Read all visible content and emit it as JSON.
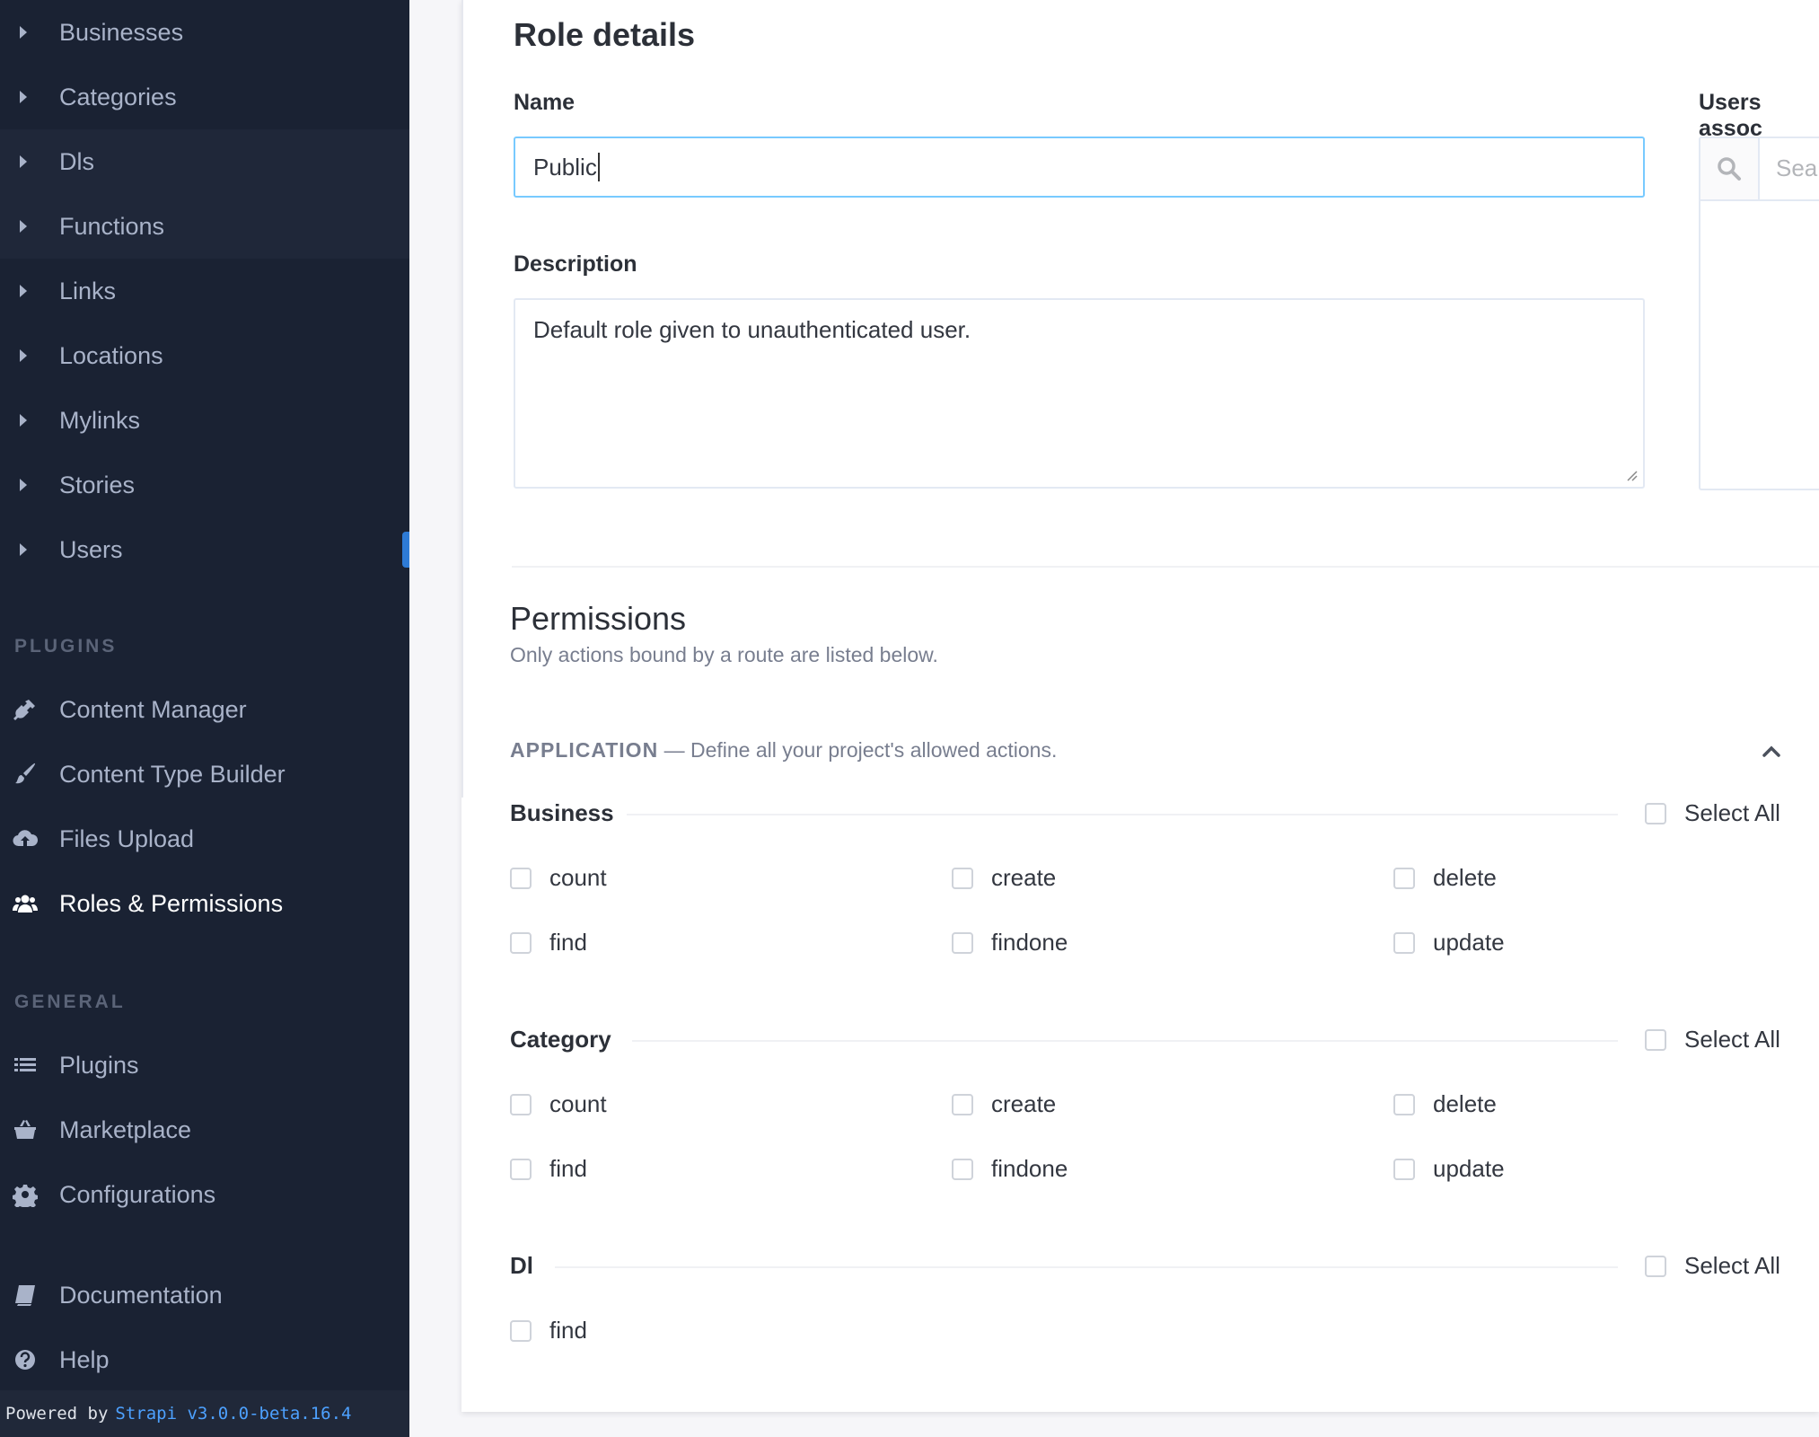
{
  "sidebar": {
    "content_types": [
      {
        "label": "Businesses"
      },
      {
        "label": "Categories"
      },
      {
        "label": "Dls"
      },
      {
        "label": "Functions"
      },
      {
        "label": "Links"
      },
      {
        "label": "Locations"
      },
      {
        "label": "Mylinks"
      },
      {
        "label": "Stories"
      },
      {
        "label": "Users"
      }
    ],
    "plugins_heading": "PLUGINS",
    "plugins": [
      {
        "label": "Content Manager",
        "icon": "plug-icon"
      },
      {
        "label": "Content Type Builder",
        "icon": "paintbrush-icon"
      },
      {
        "label": "Files Upload",
        "icon": "cloud-upload-icon"
      },
      {
        "label": "Roles & Permissions",
        "icon": "users-icon",
        "active": true
      }
    ],
    "general_heading": "GENERAL",
    "general": [
      {
        "label": "Plugins",
        "icon": "list-icon"
      },
      {
        "label": "Marketplace",
        "icon": "basket-icon"
      },
      {
        "label": "Configurations",
        "icon": "gear-icon"
      }
    ],
    "bottom": [
      {
        "label": "Documentation",
        "icon": "book-icon"
      },
      {
        "label": "Help",
        "icon": "help-icon"
      }
    ],
    "powered_by": "Powered by",
    "powered_link": "Strapi v3.0.0-beta.16.4"
  },
  "role_details": {
    "title": "Role details",
    "name_label": "Name",
    "name_value": "Public",
    "description_label": "Description",
    "description_value": "Default role given to unauthenticated user.",
    "users_label": "Users assoc",
    "users_search_placeholder": "Sear"
  },
  "permissions": {
    "title": "Permissions",
    "subtitle": "Only actions bound by a route are listed below.",
    "application_name": "APPLICATION",
    "application_dash": "—",
    "application_desc": "Define all your project's allowed actions.",
    "select_all_label": "Select All",
    "groups": [
      {
        "name": "Business",
        "actions": [
          "count",
          "create",
          "delete",
          "find",
          "findone",
          "update"
        ]
      },
      {
        "name": "Category",
        "actions": [
          "count",
          "create",
          "delete",
          "find",
          "findone",
          "update"
        ]
      },
      {
        "name": "Dl",
        "actions": [
          "find"
        ]
      }
    ]
  },
  "colors": {
    "sidebar_bg": "#1a2233",
    "accent": "#2e7bd6",
    "link": "#4da1ff",
    "focus_border": "#78caff"
  }
}
